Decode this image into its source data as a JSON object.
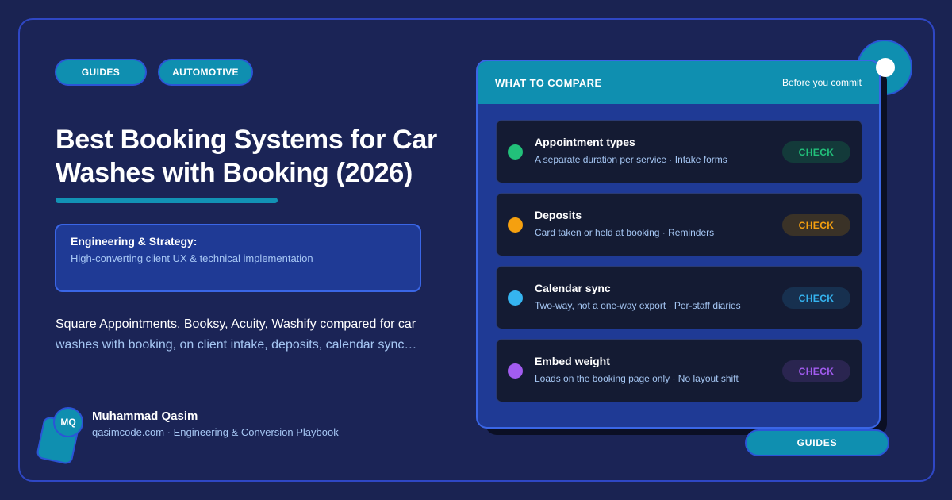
{
  "tags": [
    "GUIDES",
    "AUTOMOTIVE"
  ],
  "article": {
    "title": "Best Booking Systems for Car Washes with Booking (2026)",
    "callout_heading": "Engineering & Strategy:",
    "callout_body": "High-converting client UX & technical implementation",
    "description_line1": "Square Appointments, Booksy, Acuity, Washify compared for car",
    "description_line2": "washes with booking, on client intake, deposits, calendar sync…"
  },
  "author": {
    "initials": "MQ",
    "name": "Muhammad Qasim",
    "subtitle": "qasimcode.com · Engineering & Conversion Playbook"
  },
  "panel": {
    "title": "WHAT TO COMPARE",
    "subtitle": "Before you commit",
    "items": [
      {
        "name": "Appointment types",
        "detail": "A separate duration per service · Intake forms",
        "action": "CHECK",
        "color": "#22c07a",
        "action_bg": "#133a3a",
        "action_color": "#22c07a"
      },
      {
        "name": "Deposits",
        "detail": "Card taken or held at booking · Reminders",
        "action": "CHECK",
        "color": "#f5a00f",
        "action_bg": "#3a3227",
        "action_color": "#f5a00f"
      },
      {
        "name": "Calendar sync",
        "detail": "Two-way, not a one-way export · Per-staff diaries",
        "action": "CHECK",
        "color": "#35b4f0",
        "action_bg": "#17304f",
        "action_color": "#35b4f0"
      },
      {
        "name": "Embed weight",
        "detail": "Loads on the booking page only · No layout shift",
        "action": "CHECK",
        "color": "#a25cf0",
        "action_bg": "#2a2550",
        "action_color": "#a25cf0"
      }
    ]
  },
  "footer_tag": "GUIDES"
}
